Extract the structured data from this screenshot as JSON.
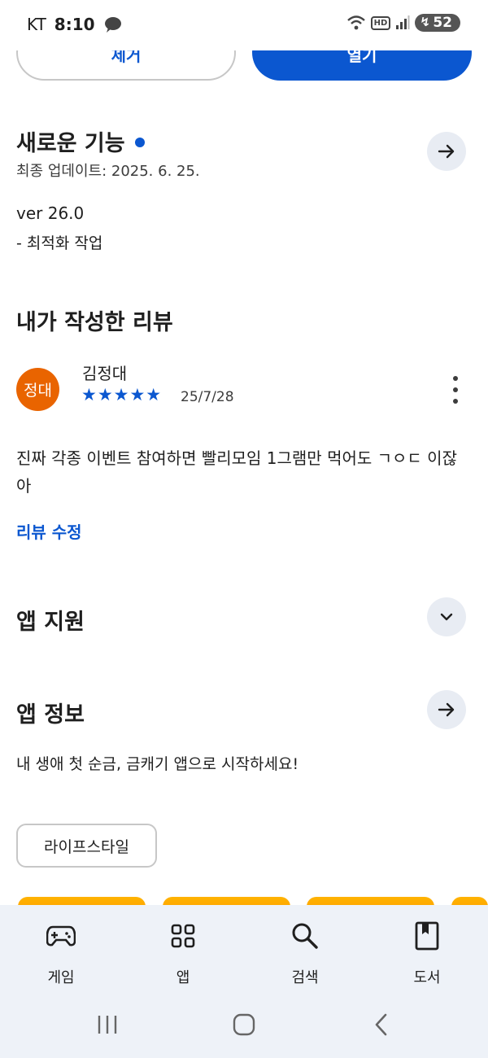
{
  "status_bar": {
    "carrier": "KT",
    "time": "8:10",
    "hd": "HD",
    "battery": "52"
  },
  "actions": {
    "remove_label": "제거",
    "open_label": "열기"
  },
  "whats_new": {
    "title": "새로운 기능",
    "updated": "최종 업데이트: 2025. 6. 25.",
    "version": "ver 26.0",
    "note": "- 최적화 작업"
  },
  "my_review": {
    "title": "내가 작성한 리뷰",
    "avatar_text": "정대",
    "reviewer": "김정대",
    "stars": "★★★★★",
    "rating": 5,
    "date": "25/7/28",
    "body": "진짜 각종 이벤트 참여하면 빨리모임 1그램만 먹어도 ㄱㅇㄷ 이잖아",
    "edit_label": "리뷰 수정"
  },
  "app_support": {
    "title": "앱 지원"
  },
  "app_info": {
    "title": "앱 정보",
    "description": "내 생애 첫 순금, 금캐기 앱으로 시작하세요!",
    "category_chip": "라이프스타일"
  },
  "colors": {
    "accent": "#0b57d0",
    "avatar_bg": "#e96400",
    "nav_bg": "#eef2f8",
    "promo": "#ffb300"
  },
  "bottom_nav": {
    "items": [
      {
        "label": "게임",
        "icon": "gamepad-icon"
      },
      {
        "label": "앱",
        "icon": "apps-grid-icon"
      },
      {
        "label": "검색",
        "icon": "search-icon"
      },
      {
        "label": "도서",
        "icon": "book-icon"
      }
    ]
  }
}
